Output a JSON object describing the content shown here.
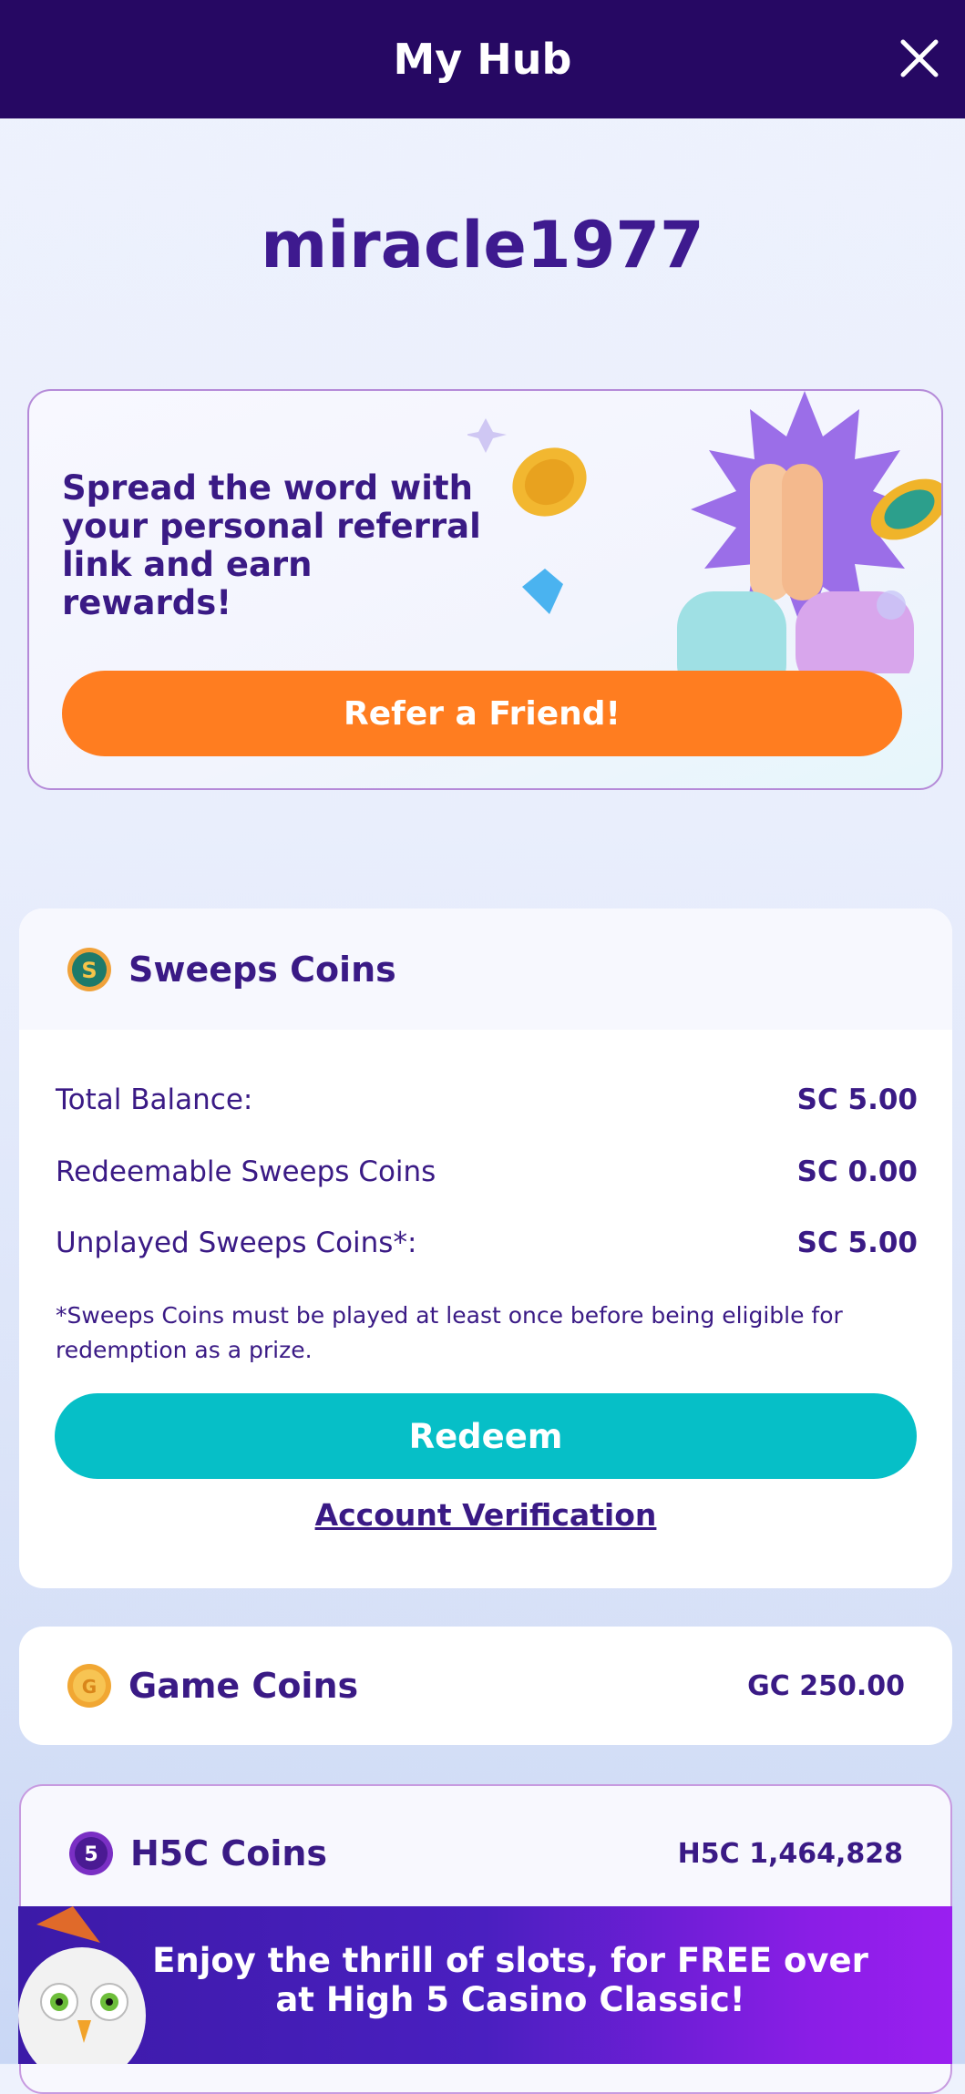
{
  "header": {
    "title": "My Hub"
  },
  "profile": {
    "username": "miracle1977"
  },
  "referral": {
    "text": "Spread the word with your personal referral link and earn rewards!",
    "button_label": "Refer a Friend!"
  },
  "sweeps": {
    "title": "Sweeps Coins",
    "rows": [
      {
        "label": "Total Balance:",
        "value": "SC 5.00"
      },
      {
        "label": "Redeemable Sweeps Coins",
        "value": "SC 0.00"
      },
      {
        "label": "Unplayed Sweeps Coins*:",
        "value": "SC 5.00"
      }
    ],
    "note": "*Sweeps Coins must be played at least once before being eligible for redemption as a prize.",
    "redeem_label": "Redeem",
    "verify_label": "Account Verification"
  },
  "game_coins": {
    "title": "Game Coins",
    "value": "GC 250.00"
  },
  "h5c_coins": {
    "title": "H5C Coins",
    "value": "H5C 1,464,828"
  },
  "promo": {
    "text": "Enjoy the thrill of slots, for FREE over at High 5 Casino Classic!"
  },
  "colors": {
    "header_bg": "#260863",
    "accent_orange": "#ff7d20",
    "accent_teal": "#06bfc7",
    "text_purple": "#3a1a85"
  },
  "icons": [
    "close-icon",
    "sweeps-coin-icon",
    "game-coin-icon",
    "h5c-coin-icon"
  ]
}
